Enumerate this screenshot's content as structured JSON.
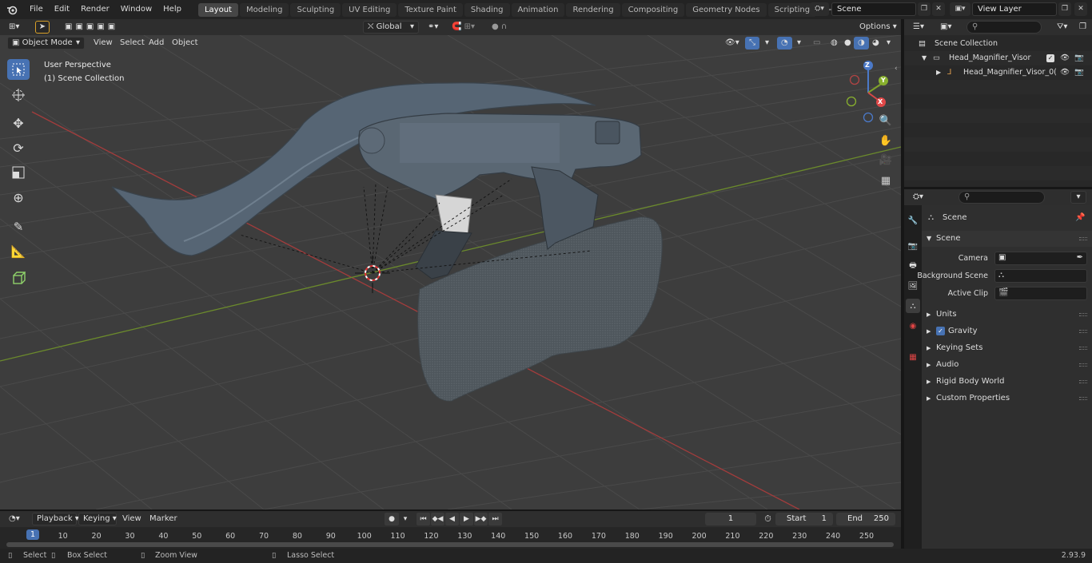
{
  "app": {
    "menu": [
      "File",
      "Edit",
      "Render",
      "Window",
      "Help"
    ],
    "workspace_tabs": [
      "Layout",
      "Modeling",
      "Sculpting",
      "UV Editing",
      "Texture Paint",
      "Shading",
      "Animation",
      "Rendering",
      "Compositing",
      "Geometry Nodes",
      "Scripting"
    ],
    "active_tab": "Layout",
    "add_tab": "+",
    "scene_name": "Scene",
    "view_layer": "View Layer",
    "version": "2.93.9"
  },
  "viewport": {
    "mode": "Object Mode",
    "menus": [
      "View",
      "Select",
      "Add",
      "Object"
    ],
    "transform_orientation": "Global",
    "options_label": "Options",
    "perspective_label": "User Perspective",
    "collection_label": "(1) Scene Collection",
    "gizmo_axes": {
      "x": "X",
      "y": "Y",
      "z": "Z"
    }
  },
  "outliner": {
    "search_placeholder": "",
    "root": "Scene Collection",
    "items": [
      {
        "name": "Head_Magnifier_Visor",
        "type": "collection"
      },
      {
        "name": "Head_Magnifier_Visor_0(",
        "type": "object"
      }
    ]
  },
  "properties": {
    "context": "Scene",
    "panel": "Scene",
    "fields": [
      {
        "label": "Camera",
        "value": ""
      },
      {
        "label": "Background Scene",
        "value": ""
      },
      {
        "label": "Active Clip",
        "value": ""
      }
    ],
    "subpanels": [
      "Units",
      "Gravity",
      "Keying Sets",
      "Audio",
      "Rigid Body World",
      "Custom Properties"
    ],
    "gravity_checked": true
  },
  "timeline": {
    "menus": [
      "Playback",
      "Keying",
      "View",
      "Marker"
    ],
    "current_frame": "1",
    "start_label": "Start",
    "start": "1",
    "end_label": "End",
    "end": "250",
    "ticks": [
      "1",
      "10",
      "20",
      "30",
      "40",
      "50",
      "60",
      "70",
      "80",
      "90",
      "100",
      "110",
      "120",
      "130",
      "140",
      "150",
      "160",
      "170",
      "180",
      "190",
      "200",
      "210",
      "220",
      "230",
      "240",
      "250"
    ]
  },
  "statusbar": {
    "select": "Select",
    "box_select": "Box Select",
    "zoom_view": "Zoom View",
    "lasso_select": "Lasso Select"
  },
  "colors": {
    "accent": "#4772b3",
    "x_axis": "#b04040",
    "y_axis": "#6e8c2e",
    "background": "#3d3d3d"
  }
}
